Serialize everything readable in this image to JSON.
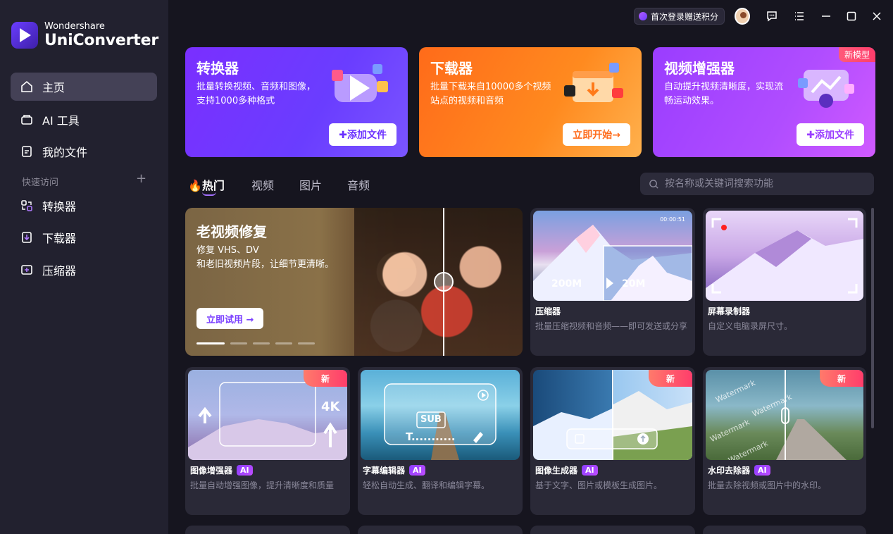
{
  "app": {
    "brand_top": "Wondershare",
    "brand_main": "UniConverter"
  },
  "sidebar": {
    "items": [
      {
        "label": "主页",
        "icon": "home-icon"
      },
      {
        "label": "AI 工具",
        "icon": "ai-tools-icon"
      },
      {
        "label": "我的文件",
        "icon": "file-icon"
      }
    ],
    "quick_access_label": "快速访问",
    "quick_items": [
      {
        "label": "转换器",
        "icon": "converter-icon"
      },
      {
        "label": "下载器",
        "icon": "downloader-icon"
      },
      {
        "label": "压缩器",
        "icon": "compressor-icon"
      }
    ]
  },
  "titlebar": {
    "promo": "首次登录赠送积分"
  },
  "cards": [
    {
      "title": "转换器",
      "desc": "批量转换视频、音频和图像，支持1000多种格式",
      "button": "✚添加文件"
    },
    {
      "title": "下载器",
      "desc": "批量下载来自10000多个视频站点的视频和音频",
      "button": "立即开始→"
    },
    {
      "title": "视频增强器",
      "desc": "自动提升视频清晰度，实现流畅运动效果。",
      "button": "✚添加文件",
      "badge": "新模型"
    }
  ],
  "tabs": [
    "热门",
    "视频",
    "图片",
    "音频"
  ],
  "search": {
    "placeholder": "按名称或关键词搜索功能"
  },
  "hero": {
    "title": "老视频修复",
    "desc_line1": "修复 VHS、DV",
    "desc_line2": "和老旧视频片段，让细节更清晰。",
    "button": "立即试用 →"
  },
  "tools": [
    {
      "name": "压缩器",
      "sub": "批量压缩视频和音频——即可发送或分享",
      "ai": false,
      "new": false,
      "overlay": {
        "size_from": "200M",
        "size_to": "20M",
        "time": "00:00:51"
      }
    },
    {
      "name": "屏幕录制器",
      "sub": "自定义电脑录屏尺寸。",
      "ai": false,
      "new": false
    },
    {
      "name": "图像增强器",
      "sub": "批量自动增强图像，提升清晰度和质量",
      "ai": true,
      "new": true,
      "overlay": {
        "res": "4K"
      }
    },
    {
      "name": "字幕编辑器",
      "sub": "轻松自动生成、翻译和编辑字幕。",
      "ai": true,
      "new": false,
      "overlay": {
        "sub_label": "SUB",
        "text_label": "T..........."
      }
    },
    {
      "name": "图像生成器",
      "sub": "基于文字、图片或模板生成图片。",
      "ai": true,
      "new": true
    },
    {
      "name": "水印去除器",
      "sub": "批量去除视频或图片中的水印。",
      "ai": true,
      "new": true,
      "overlay": {
        "watermark": "Watermark"
      }
    }
  ],
  "labels": {
    "ai": "AI",
    "new": "新"
  },
  "colors": {
    "converter": "#7b3fff",
    "downloader": "#ff7a1a",
    "enhancer": "#b04dff",
    "accent": "#a470ff"
  }
}
